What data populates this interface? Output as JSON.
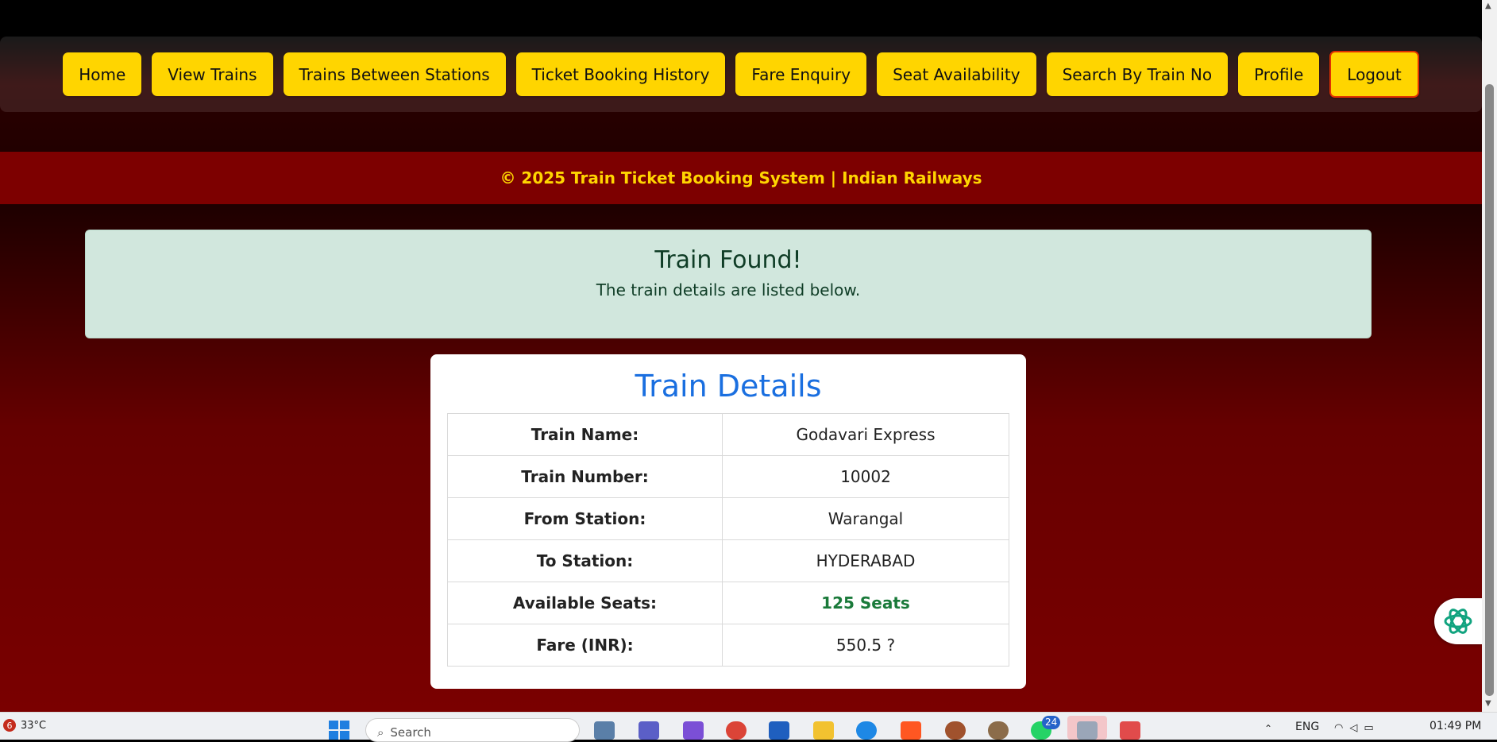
{
  "nav": {
    "items": [
      {
        "label": "Home",
        "name": "nav-home-button"
      },
      {
        "label": "View Trains",
        "name": "nav-view-trains-button"
      },
      {
        "label": "Trains Between Stations",
        "name": "nav-trains-between-stations-button"
      },
      {
        "label": "Ticket Booking History",
        "name": "nav-ticket-booking-history-button"
      },
      {
        "label": "Fare Enquiry",
        "name": "nav-fare-enquiry-button"
      },
      {
        "label": "Seat Availability",
        "name": "nav-seat-availability-button"
      },
      {
        "label": "Search By Train No",
        "name": "nav-search-by-train-no-button"
      },
      {
        "label": "Profile",
        "name": "nav-profile-button"
      },
      {
        "label": "Logout",
        "name": "nav-logout-button"
      }
    ]
  },
  "banner": {
    "text": "© 2025 Train Ticket Booking System | Indian Railways"
  },
  "alert": {
    "title": "Train Found!",
    "message": "The train details are listed below."
  },
  "details": {
    "title": "Train Details",
    "rows": [
      {
        "label": "Train Name:",
        "value": "Godavari Express"
      },
      {
        "label": "Train Number:",
        "value": "10002"
      },
      {
        "label": "From Station:",
        "value": "Warangal"
      },
      {
        "label": "To Station:",
        "value": "HYDERABAD"
      },
      {
        "label": "Available Seats:",
        "value": "125 Seats"
      },
      {
        "label": "Fare (INR):",
        "value": "550.5 ?"
      }
    ]
  },
  "taskbar": {
    "weather_badge": "6",
    "temperature": "33°C",
    "search_placeholder": "Search",
    "whatsapp_badge": "24",
    "language": "ENG",
    "time": "01:49 PM"
  },
  "colors": {
    "nav_button": "#ffd500",
    "banner_bg": "#7d0000",
    "alert_bg": "#d1e7dd",
    "details_title": "#1a6fe0",
    "seats_green": "#1a7a3a"
  }
}
